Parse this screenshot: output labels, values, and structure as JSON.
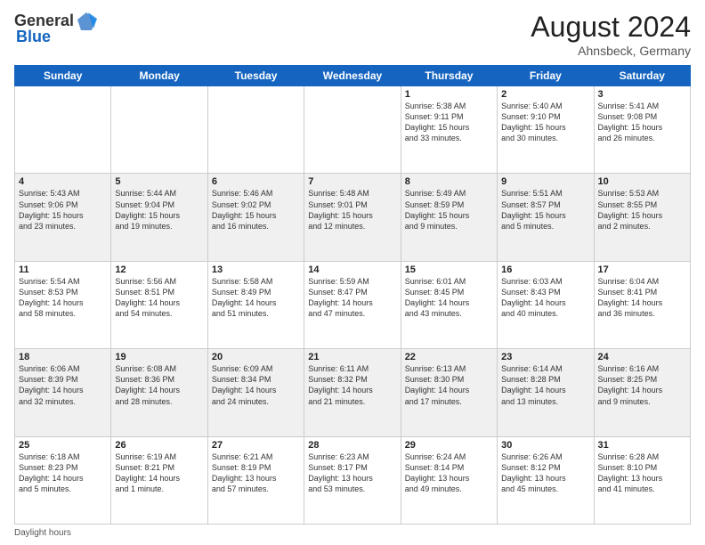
{
  "header": {
    "logo_general": "General",
    "logo_blue": "Blue",
    "month_year": "August 2024",
    "location": "Ahnsbeck, Germany"
  },
  "days_of_week": [
    "Sunday",
    "Monday",
    "Tuesday",
    "Wednesday",
    "Thursday",
    "Friday",
    "Saturday"
  ],
  "footer": {
    "note": "Daylight hours"
  },
  "weeks": [
    [
      {
        "num": "",
        "info": ""
      },
      {
        "num": "",
        "info": ""
      },
      {
        "num": "",
        "info": ""
      },
      {
        "num": "",
        "info": ""
      },
      {
        "num": "1",
        "info": "Sunrise: 5:38 AM\nSunset: 9:11 PM\nDaylight: 15 hours\nand 33 minutes."
      },
      {
        "num": "2",
        "info": "Sunrise: 5:40 AM\nSunset: 9:10 PM\nDaylight: 15 hours\nand 30 minutes."
      },
      {
        "num": "3",
        "info": "Sunrise: 5:41 AM\nSunset: 9:08 PM\nDaylight: 15 hours\nand 26 minutes."
      }
    ],
    [
      {
        "num": "4",
        "info": "Sunrise: 5:43 AM\nSunset: 9:06 PM\nDaylight: 15 hours\nand 23 minutes."
      },
      {
        "num": "5",
        "info": "Sunrise: 5:44 AM\nSunset: 9:04 PM\nDaylight: 15 hours\nand 19 minutes."
      },
      {
        "num": "6",
        "info": "Sunrise: 5:46 AM\nSunset: 9:02 PM\nDaylight: 15 hours\nand 16 minutes."
      },
      {
        "num": "7",
        "info": "Sunrise: 5:48 AM\nSunset: 9:01 PM\nDaylight: 15 hours\nand 12 minutes."
      },
      {
        "num": "8",
        "info": "Sunrise: 5:49 AM\nSunset: 8:59 PM\nDaylight: 15 hours\nand 9 minutes."
      },
      {
        "num": "9",
        "info": "Sunrise: 5:51 AM\nSunset: 8:57 PM\nDaylight: 15 hours\nand 5 minutes."
      },
      {
        "num": "10",
        "info": "Sunrise: 5:53 AM\nSunset: 8:55 PM\nDaylight: 15 hours\nand 2 minutes."
      }
    ],
    [
      {
        "num": "11",
        "info": "Sunrise: 5:54 AM\nSunset: 8:53 PM\nDaylight: 14 hours\nand 58 minutes."
      },
      {
        "num": "12",
        "info": "Sunrise: 5:56 AM\nSunset: 8:51 PM\nDaylight: 14 hours\nand 54 minutes."
      },
      {
        "num": "13",
        "info": "Sunrise: 5:58 AM\nSunset: 8:49 PM\nDaylight: 14 hours\nand 51 minutes."
      },
      {
        "num": "14",
        "info": "Sunrise: 5:59 AM\nSunset: 8:47 PM\nDaylight: 14 hours\nand 47 minutes."
      },
      {
        "num": "15",
        "info": "Sunrise: 6:01 AM\nSunset: 8:45 PM\nDaylight: 14 hours\nand 43 minutes."
      },
      {
        "num": "16",
        "info": "Sunrise: 6:03 AM\nSunset: 8:43 PM\nDaylight: 14 hours\nand 40 minutes."
      },
      {
        "num": "17",
        "info": "Sunrise: 6:04 AM\nSunset: 8:41 PM\nDaylight: 14 hours\nand 36 minutes."
      }
    ],
    [
      {
        "num": "18",
        "info": "Sunrise: 6:06 AM\nSunset: 8:39 PM\nDaylight: 14 hours\nand 32 minutes."
      },
      {
        "num": "19",
        "info": "Sunrise: 6:08 AM\nSunset: 8:36 PM\nDaylight: 14 hours\nand 28 minutes."
      },
      {
        "num": "20",
        "info": "Sunrise: 6:09 AM\nSunset: 8:34 PM\nDaylight: 14 hours\nand 24 minutes."
      },
      {
        "num": "21",
        "info": "Sunrise: 6:11 AM\nSunset: 8:32 PM\nDaylight: 14 hours\nand 21 minutes."
      },
      {
        "num": "22",
        "info": "Sunrise: 6:13 AM\nSunset: 8:30 PM\nDaylight: 14 hours\nand 17 minutes."
      },
      {
        "num": "23",
        "info": "Sunrise: 6:14 AM\nSunset: 8:28 PM\nDaylight: 14 hours\nand 13 minutes."
      },
      {
        "num": "24",
        "info": "Sunrise: 6:16 AM\nSunset: 8:25 PM\nDaylight: 14 hours\nand 9 minutes."
      }
    ],
    [
      {
        "num": "25",
        "info": "Sunrise: 6:18 AM\nSunset: 8:23 PM\nDaylight: 14 hours\nand 5 minutes."
      },
      {
        "num": "26",
        "info": "Sunrise: 6:19 AM\nSunset: 8:21 PM\nDaylight: 14 hours\nand 1 minute."
      },
      {
        "num": "27",
        "info": "Sunrise: 6:21 AM\nSunset: 8:19 PM\nDaylight: 13 hours\nand 57 minutes."
      },
      {
        "num": "28",
        "info": "Sunrise: 6:23 AM\nSunset: 8:17 PM\nDaylight: 13 hours\nand 53 minutes."
      },
      {
        "num": "29",
        "info": "Sunrise: 6:24 AM\nSunset: 8:14 PM\nDaylight: 13 hours\nand 49 minutes."
      },
      {
        "num": "30",
        "info": "Sunrise: 6:26 AM\nSunset: 8:12 PM\nDaylight: 13 hours\nand 45 minutes."
      },
      {
        "num": "31",
        "info": "Sunrise: 6:28 AM\nSunset: 8:10 PM\nDaylight: 13 hours\nand 41 minutes."
      }
    ]
  ]
}
